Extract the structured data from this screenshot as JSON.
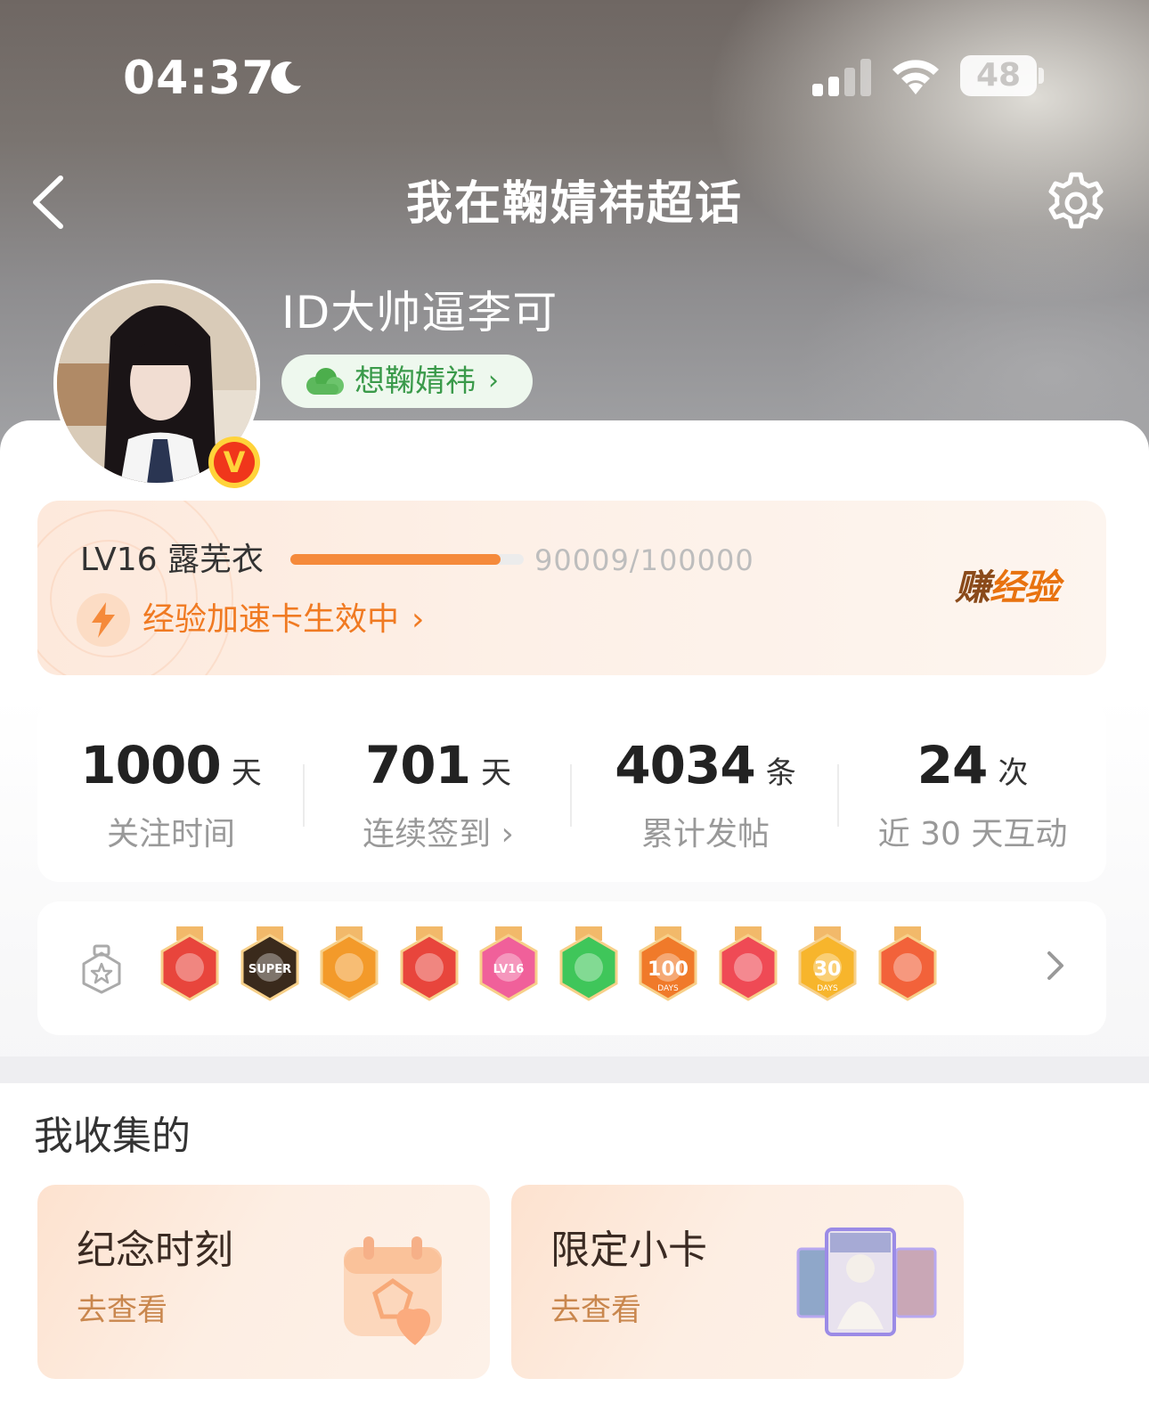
{
  "status_bar": {
    "time": "04:37",
    "battery": "48"
  },
  "nav": {
    "title": "我在鞠婧祎超话"
  },
  "profile": {
    "username": "ID大帅逼李可",
    "fan_group": "想鞠婧祎",
    "verified_badge": "V"
  },
  "level": {
    "label": "LV16 露芜衣",
    "progress_text": "90009/100000",
    "progress_fraction": 0.90009,
    "boost_text": "经验加速卡生效中",
    "earn_button": "赚经验"
  },
  "stats": [
    {
      "value": "1000",
      "unit": "天",
      "label": "关注时间"
    },
    {
      "value": "701",
      "unit": "天",
      "label": "连续签到 ›"
    },
    {
      "value": "4034",
      "unit": "条",
      "label": "累计发帖"
    },
    {
      "value": "24",
      "unit": "次",
      "label": "近 30 天互动"
    }
  ],
  "badges": {
    "items": [
      {
        "name": "cat-badge",
        "color": "#e8453c",
        "text": ""
      },
      {
        "name": "super-badge",
        "color": "#3a2a1c",
        "text": "SUPER"
      },
      {
        "name": "crown-badge",
        "color": "#f39a2a",
        "text": ""
      },
      {
        "name": "cat-2-badge",
        "color": "#e8453c",
        "text": ""
      },
      {
        "name": "lv16-badge",
        "color": "#f0609a",
        "text": "LV16"
      },
      {
        "name": "hand-badge",
        "color": "#3fc65a",
        "text": ""
      },
      {
        "name": "100-days-badge",
        "color": "#f07a2a",
        "text": "100"
      },
      {
        "name": "trophy-badge",
        "color": "#ef4a55",
        "text": ""
      },
      {
        "name": "30-days-badge",
        "color": "#f7b52c",
        "text": "30"
      },
      {
        "name": "rock-hand-badge",
        "color": "#f2623a",
        "text": ""
      }
    ],
    "days_caption": "DAYS"
  },
  "collected": {
    "title": "我收集的",
    "cards": [
      {
        "title": "纪念时刻",
        "subtitle": "去查看"
      },
      {
        "title": "限定小卡",
        "subtitle": "去查看"
      }
    ]
  },
  "colors": {
    "accent_orange": "#f58a3b",
    "fan_green": "#3a9a4a"
  }
}
